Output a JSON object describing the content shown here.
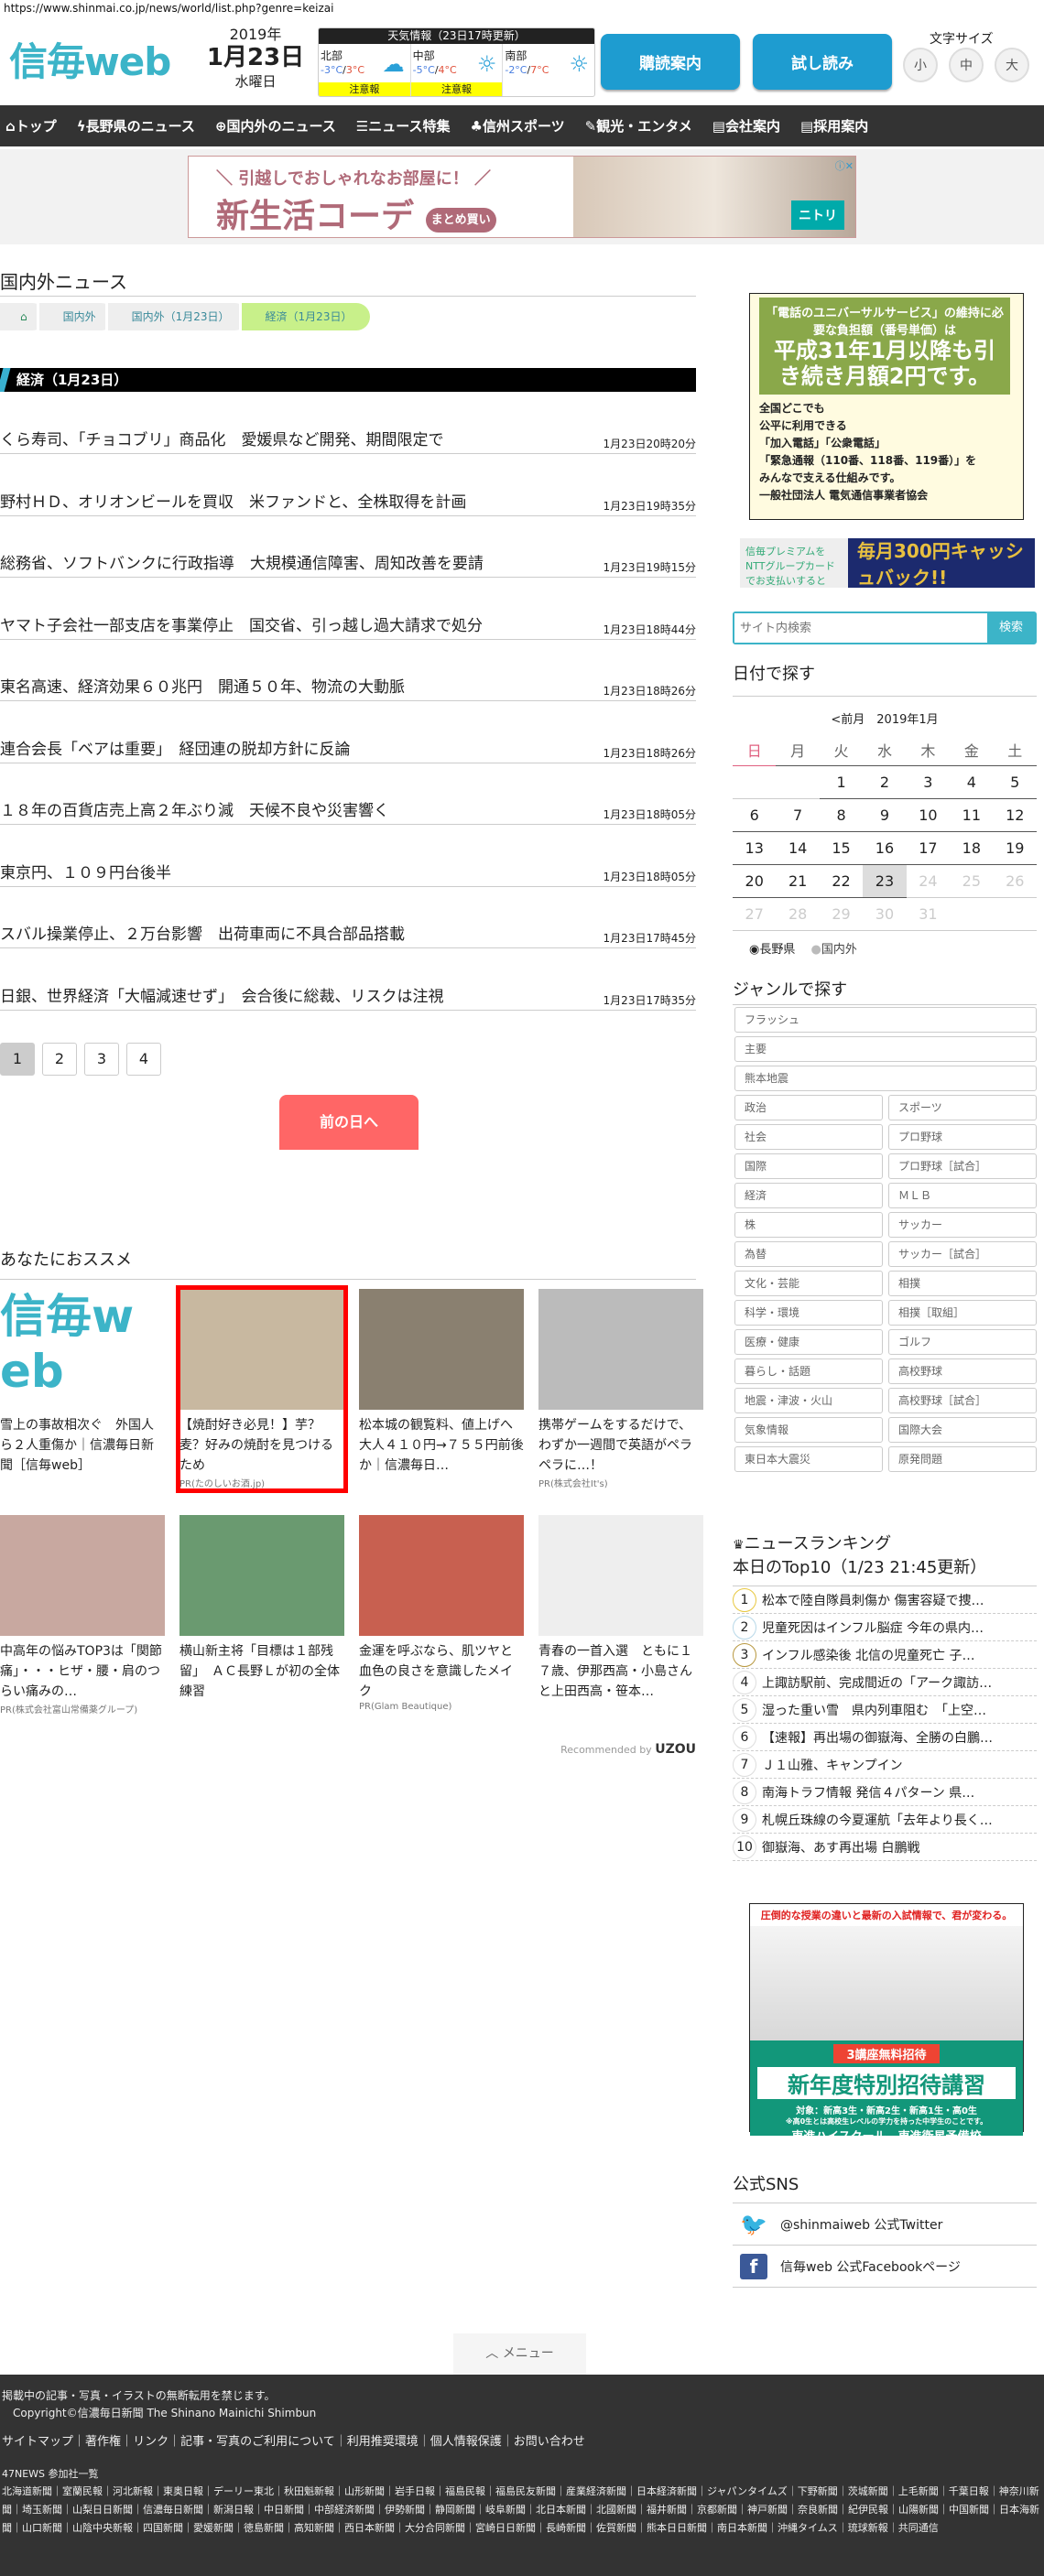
{
  "url": "https://www.shinmai.co.jp/news/world/list.php?genre=keizai",
  "header": {
    "logo": "信毎web",
    "year": "2019年",
    "date": "1月23日",
    "weekday": "水曜日",
    "weather": {
      "title": "天気情報（23日17時更新）",
      "regions": [
        {
          "name": "北部",
          "low": "-3°C",
          "high": "3°C",
          "icon": "snowman-cloud-icon",
          "warning": "注意報"
        },
        {
          "name": "中部",
          "low": "-5°C",
          "high": "4°C",
          "icon": "sun-icon",
          "warning": "注意報"
        },
        {
          "name": "南部",
          "low": "-2°C",
          "high": "7°C",
          "icon": "sun-icon",
          "warning": ""
        }
      ]
    },
    "subscribe": "購読案内",
    "trial": "試し読み",
    "font_size_label": "文字サイズ",
    "font_sizes": [
      "小",
      "中",
      "大"
    ]
  },
  "nav": [
    "トップ",
    "長野県のニュース",
    "国内外のニュース",
    "ニュース特集",
    "信州スポーツ",
    "観光・エンタメ",
    "会社案内",
    "採用案内"
  ],
  "ad_top": {
    "sub": "＼ 引越しでおしゃれなお部屋に！ ／",
    "main": "新生活コーデ",
    "bubble": "まとめ買い",
    "brand": "ニトリ"
  },
  "page_title": "国内外ニュース",
  "breadcrumb": [
    "国内外",
    "国内外（1月23日）",
    "経済（1月23日）"
  ],
  "section": "経済（1月23日）",
  "news": [
    {
      "title": "くら寿司、「チョコブリ」商品化　愛媛県など開発、期間限定で",
      "time": "1月23日20時20分"
    },
    {
      "title": "野村ＨＤ、オリオンビールを買収　米ファンドと、全株取得を計画",
      "time": "1月23日19時35分"
    },
    {
      "title": "総務省、ソフトバンクに行政指導　大規模通信障害、周知改善を要請",
      "time": "1月23日19時15分"
    },
    {
      "title": "ヤマト子会社一部支店を事業停止　国交省、引っ越し過大請求で処分",
      "time": "1月23日18時44分"
    },
    {
      "title": "東名高速、経済効果６０兆円　開通５０年、物流の大動脈",
      "time": "1月23日18時26分"
    },
    {
      "title": "連合会長「ベアは重要」　経団連の脱却方針に反論",
      "time": "1月23日18時26分"
    },
    {
      "title": "１８年の百貨店売上高２年ぶり減　天候不良や災害響く",
      "time": "1月23日18時05分"
    },
    {
      "title": "東京円、１０９円台後半",
      "time": "1月23日18時05分"
    },
    {
      "title": "スバル操業停止、２万台影響　出荷車両に不具合部品搭載",
      "time": "1月23日17時45分"
    },
    {
      "title": "日銀、世界経済「大幅減速せず」　会合後に総裁、リスクは注視",
      "time": "1月23日17時35分"
    }
  ],
  "pages": [
    "1",
    "2",
    "3",
    "4"
  ],
  "prev_day": "前の日へ",
  "recommend": {
    "title": "あなたにおススメ",
    "items": [
      {
        "text": "雪上の事故相次ぐ　外国人ら２人重傷か｜信濃毎日新聞［信毎web］",
        "pr": ""
      },
      {
        "text": "【焼酎好き必見！】芋？麦？好みの焼酎を見つけるため",
        "pr": "PR(たのしいお酒.jp)"
      },
      {
        "text": "松本城の観覧料、値上げへ　大人４１０円→７５５円前後か｜信濃毎日…",
        "pr": ""
      },
      {
        "text": "携帯ゲームをするだけで、わずか一週間で英語がペラペラに…！",
        "pr": "PR(株式会社It's)"
      },
      {
        "text": "中高年の悩みTOP3は「関節痛」・・・ヒザ・腰・肩のつらい痛みの…",
        "pr": "PR(株式会社富山常備薬グループ)"
      },
      {
        "text": "横山新主将「目標は１部残留」　ＡＣ長野Ｌが初の全体練習",
        "pr": ""
      },
      {
        "text": "金運を呼ぶなら、肌ツヤと血色の良さを意識したメイク",
        "pr": "PR(Glam Beautique)"
      },
      {
        "text": "青春の一首入選　ともに１７歳、伊那西高・小島さんと上田西高・笹本…",
        "pr": ""
      }
    ],
    "recommended_by": "Recommended by",
    "uzou": "UZOU"
  },
  "side": {
    "ad_universal": {
      "head": "「電話のユニバーサルサービス」の維持に必要な負担額（番号単価）は",
      "big": "平成31年1月以降も引き続き月額2円です。",
      "lines": [
        "全国どこでも",
        "公平に利用できる",
        "「加入電話」「公衆電話」",
        "「緊急通報（110番、118番、119番）」を",
        "みんなで支える仕組みです。",
        "一般社団法人 電気通信事業者協会"
      ]
    },
    "ad_premium": {
      "left": "信毎プレミアムを NTTグループカードでお支払いすると",
      "right": "毎月300円キャッシュバック!!"
    },
    "search_placeholder": "サイト内検索",
    "search_button": "検索",
    "date_title": "日付で探す",
    "calendar": {
      "prev": "<前月",
      "month": "2019年1月",
      "weekdays": [
        "日",
        "月",
        "火",
        "水",
        "木",
        "金",
        "土"
      ],
      "weeks": [
        [
          "",
          "",
          "1",
          "2",
          "3",
          "4",
          "5"
        ],
        [
          "6",
          "7",
          "8",
          "9",
          "10",
          "11",
          "12"
        ],
        [
          "13",
          "14",
          "15",
          "16",
          "17",
          "18",
          "19"
        ],
        [
          "20",
          "21",
          "22",
          "23",
          "24",
          "25",
          "26"
        ],
        [
          "27",
          "28",
          "29",
          "30",
          "31",
          "",
          ""
        ]
      ],
      "today": "23"
    },
    "radios": [
      "長野県",
      "国内外"
    ],
    "genre_title": "ジャンルで探す",
    "genres_full": [
      "フラッシュ",
      "主要",
      "熊本地震"
    ],
    "genres": [
      "政治",
      "スポーツ",
      "社会",
      "プロ野球",
      "国際",
      "プロ野球［試合］",
      "経済",
      "ＭＬＢ",
      "株",
      "サッカー",
      "為替",
      "サッカー［試合］",
      "文化・芸能",
      "相撲",
      "科学・環境",
      "相撲［取組］",
      "医療・健康",
      "ゴルフ",
      "暮らし・話題",
      "高校野球",
      "地震・津波・火山",
      "高校野球［試合］",
      "気象情報",
      "国際大会",
      "東日本大震災",
      "原発問題"
    ],
    "ranking_title": "ニュースランキング",
    "ranking_sub": "本日のTop10（1/23 21:45更新）",
    "ranking": [
      "松本で陸自隊員刺傷か 傷害容疑で捜…",
      "児童死因はインフル脳症 今年の県内…",
      "インフル感染後 北信の児童死亡 子…",
      "上諏訪駅前、完成間近の「アーク諏訪…",
      "湿った重い雪　県内列車阻む　「上空…",
      "【速報】再出場の御嶽海、全勝の白鵬…",
      "Ｊ１山雅、キャンプイン",
      "南海トラフ情報 発信４パターン 県…",
      "札幌丘珠線の今夏運航「去年より長く…",
      "御嶽海、あす再出場 白鵬戦"
    ],
    "ad_toshin": {
      "top": "圧倒的な授業の違いと最新の入試情報で、君が変わる。",
      "ribbon": "3講座無料招待",
      "big": "新年度特別招待講習",
      "target": "対象：新高3生・新高2生・新高1生・高0生",
      "note": "※高0生とは高校生レベルの学力を持った中学生のことです。",
      "brands": "東進ハイスクール　東進衛星予備校"
    },
    "sns_title": "公式SNS",
    "twitter": "@shinmaiweb 公式Twitter",
    "facebook": "信毎web 公式Facebookページ"
  },
  "menu": "メニュー",
  "footer": {
    "notice": "掲載中の記事・写真・イラストの無断転用を禁じます。",
    "copyright": "Copyright©信濃毎日新聞 The Shinano Mainichi Shimbun",
    "links": [
      "サイトマップ",
      "著作権",
      "リンク",
      "記事・写真のご利用について",
      "利用推奨環境",
      "個人情報保護",
      "お問い合わせ"
    ],
    "news47_title": "47NEWS 参加社一覧",
    "news47": "北海道新聞｜室蘭民報｜河北新報｜東奥日報｜デーリー東北｜秋田魁新報｜山形新聞｜岩手日報｜福島民報｜福島民友新聞｜産業経済新聞｜日本経済新聞｜ジャパンタイムズ｜下野新聞｜茨城新聞｜上毛新聞｜千葉日報｜神奈川新聞｜埼玉新聞｜山梨日日新聞｜信濃毎日新聞｜新潟日報｜中日新聞｜中部経済新聞｜伊勢新聞｜静岡新聞｜岐阜新聞｜北日本新聞｜北國新聞｜福井新聞｜京都新聞｜神戸新聞｜奈良新聞｜紀伊民報｜山陽新聞｜中国新聞｜日本海新聞｜山口新聞｜山陰中央新報｜四国新聞｜愛媛新聞｜徳島新聞｜高知新聞｜西日本新聞｜大分合同新聞｜宮崎日日新聞｜長崎新聞｜佐賀新聞｜熊本日日新聞｜南日本新聞｜沖縄タイムス｜琉球新報｜共同通信"
  }
}
